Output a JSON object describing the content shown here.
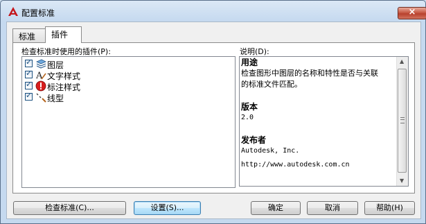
{
  "window": {
    "title": "配置标准",
    "close_label": "×"
  },
  "tabs": [
    {
      "label": "标准"
    },
    {
      "label": "插件"
    }
  ],
  "plugins": {
    "list_label": "检查标准时使用的插件(P):",
    "items": [
      {
        "label": "图层",
        "checked": true,
        "icon": "layers-icon"
      },
      {
        "label": "文字样式",
        "checked": true,
        "icon": "text-style-icon"
      },
      {
        "label": "标注样式",
        "checked": true,
        "icon": "dimension-style-icon"
      },
      {
        "label": "线型",
        "checked": true,
        "icon": "linetype-icon"
      }
    ]
  },
  "description": {
    "label": "说明(D):",
    "purpose_heading": "用途",
    "purpose_line1": "检查图形中图层的名称和特性是否与关联",
    "purpose_line2": "的标准文件匹配。",
    "version_heading": "版本",
    "version_value": "2.0",
    "publisher_heading": "发布者",
    "publisher_name": "Autodesk, Inc.",
    "publisher_url": "http://www.autodesk.com.cn"
  },
  "buttons": {
    "check": "检查标准(C)...",
    "settings": "设置(S)...",
    "ok": "确定",
    "cancel": "取消",
    "help": "帮助(H)"
  }
}
